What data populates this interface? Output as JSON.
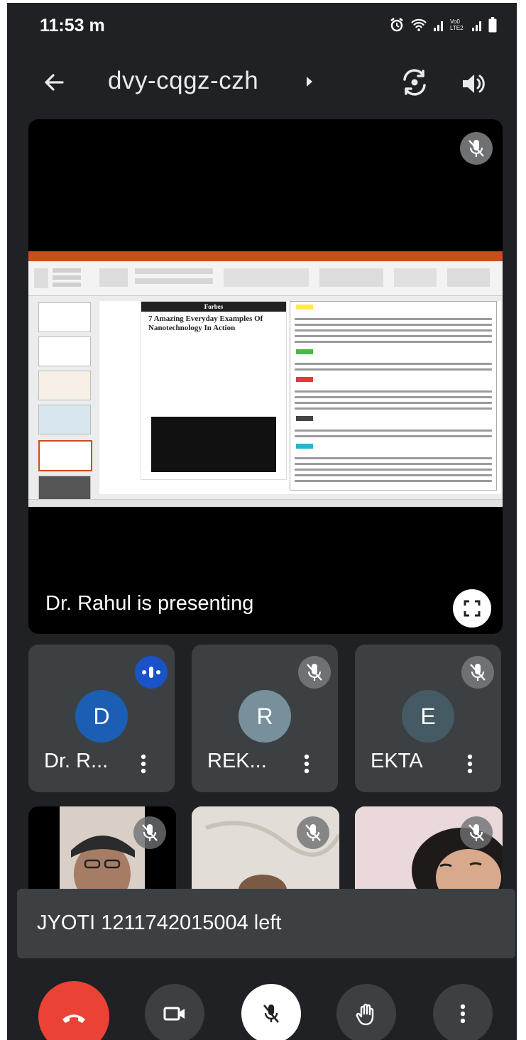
{
  "status_bar": {
    "time": "11:53 m",
    "network_label": "Vo0 LTE2"
  },
  "header": {
    "meeting_code": "dvy-cqgz-czh"
  },
  "presentation": {
    "presenter_text": "Dr. Rahul is presenting",
    "slide": {
      "article_publisher": "Forbes",
      "article_title": "7 Amazing Everyday Examples Of Nanotechnology In Action"
    }
  },
  "participants": [
    {
      "initial": "D",
      "name": "Dr. R...",
      "avatar_color": "#1a5fb4",
      "speaking": true
    },
    {
      "initial": "R",
      "name": "REK...",
      "avatar_color": "#78909c",
      "muted": true
    },
    {
      "initial": "E",
      "name": "EKTA",
      "avatar_color": "#455a64",
      "muted": true
    }
  ],
  "toast": {
    "message": "JYOTI 1211742015004 left"
  },
  "colors": {
    "background": "#202124",
    "tile": "#3c4043",
    "hangup": "#ea4335",
    "speaking": "#1a52c8"
  }
}
